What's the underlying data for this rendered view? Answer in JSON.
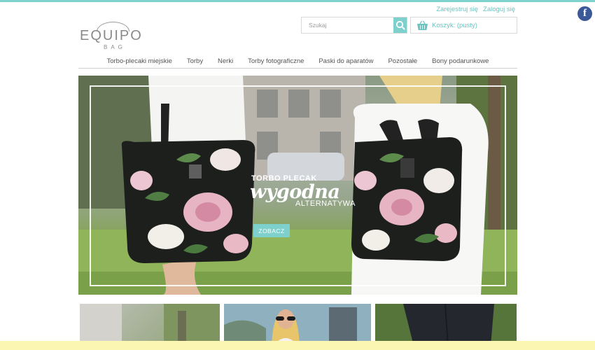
{
  "header": {
    "account": {
      "register": "Zarejestruj się",
      "login": "Zaloguj się"
    },
    "logo": {
      "main": "EQUIPO",
      "sub": "BAG"
    },
    "search": {
      "placeholder": "Szukaj",
      "icon": "search-icon"
    },
    "cart": {
      "label": "Koszyk: (pusty)",
      "icon": "basket-icon"
    },
    "social": {
      "facebook_letter": "f"
    }
  },
  "nav": {
    "items": [
      "Torbo-plecaki miejskie",
      "Torby",
      "Nerki",
      "Torby fotograficzne",
      "Paski do aparatów",
      "Pozostałe",
      "Bony podarunkowe"
    ]
  },
  "hero": {
    "kicker": "TORBO PLECAK",
    "script": "wygodna",
    "alt": "ALTERNATYWA",
    "cta": "ZOBACZ"
  },
  "colors": {
    "accent": "#7ed0cc",
    "link": "#6cc3bf",
    "facebook": "#3b5998",
    "bottom_bar": "#fbf6b2"
  }
}
